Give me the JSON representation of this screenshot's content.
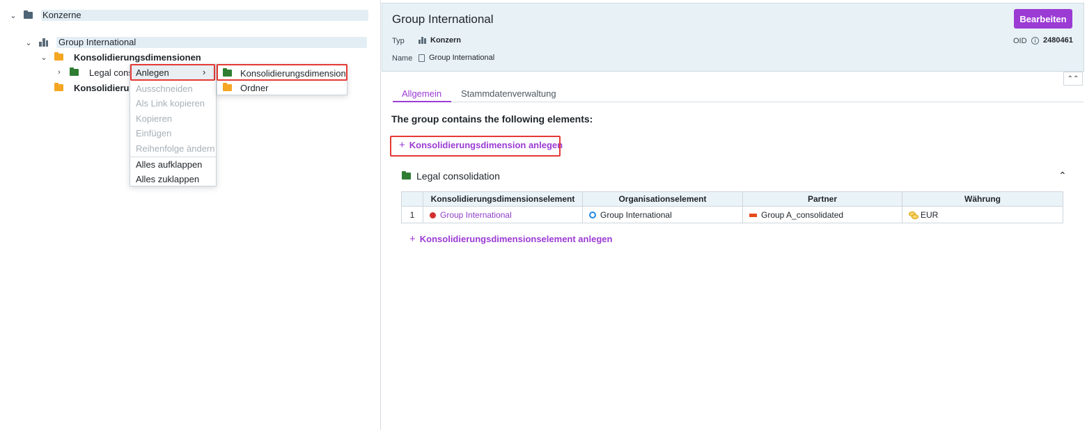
{
  "tree": {
    "root_label": "Konzerne",
    "group_label": "Group International",
    "konsolidierungsdimensionen_label": "Konsolidierungsdimensionen",
    "legal_label": "Legal cons",
    "konsolidierung_label": "Konsolidierung"
  },
  "context_menu": {
    "items": [
      {
        "label": "Anlegen"
      },
      {
        "label": "Ausschneiden"
      },
      {
        "label": "Als Link kopieren"
      },
      {
        "label": "Kopieren"
      },
      {
        "label": "Einfügen"
      },
      {
        "label": "Reihenfolge ändern"
      },
      {
        "label": "Alles aufklappen"
      },
      {
        "label": "Alles zuklappen"
      }
    ],
    "submenu": [
      {
        "label": "Konsolidierungsdimension"
      },
      {
        "label": "Ordner"
      }
    ]
  },
  "header": {
    "title": "Group International",
    "edit_button": "Bearbeiten",
    "typ_label": "Typ",
    "typ_value": "Konzern",
    "name_label": "Name",
    "name_value": "Group International",
    "oid_label": "OID",
    "oid_value": "2480461"
  },
  "tabs": [
    "Allgemein",
    "Stammdatenverwaltung"
  ],
  "content": {
    "contains_text": "The group contains the following elements:",
    "add_dimension_link": "Konsolidierungsdimension anlegen",
    "section_title": "Legal consolidation",
    "add_element_link": "Konsolidierungsdimensionselement anlegen"
  },
  "table": {
    "columns": [
      "",
      "Konsolidierungsdimensionselement",
      "Organisationselement",
      "Partner",
      "Währung"
    ],
    "rows": [
      {
        "num": "1",
        "element": "Group International",
        "org": "Group International",
        "partner": "Group A_consolidated",
        "currency": "EUR"
      }
    ]
  },
  "colors": {
    "accent": "#9b3bd4",
    "highlight_box": "#e53935",
    "header_bg": "#e8f2f6"
  }
}
